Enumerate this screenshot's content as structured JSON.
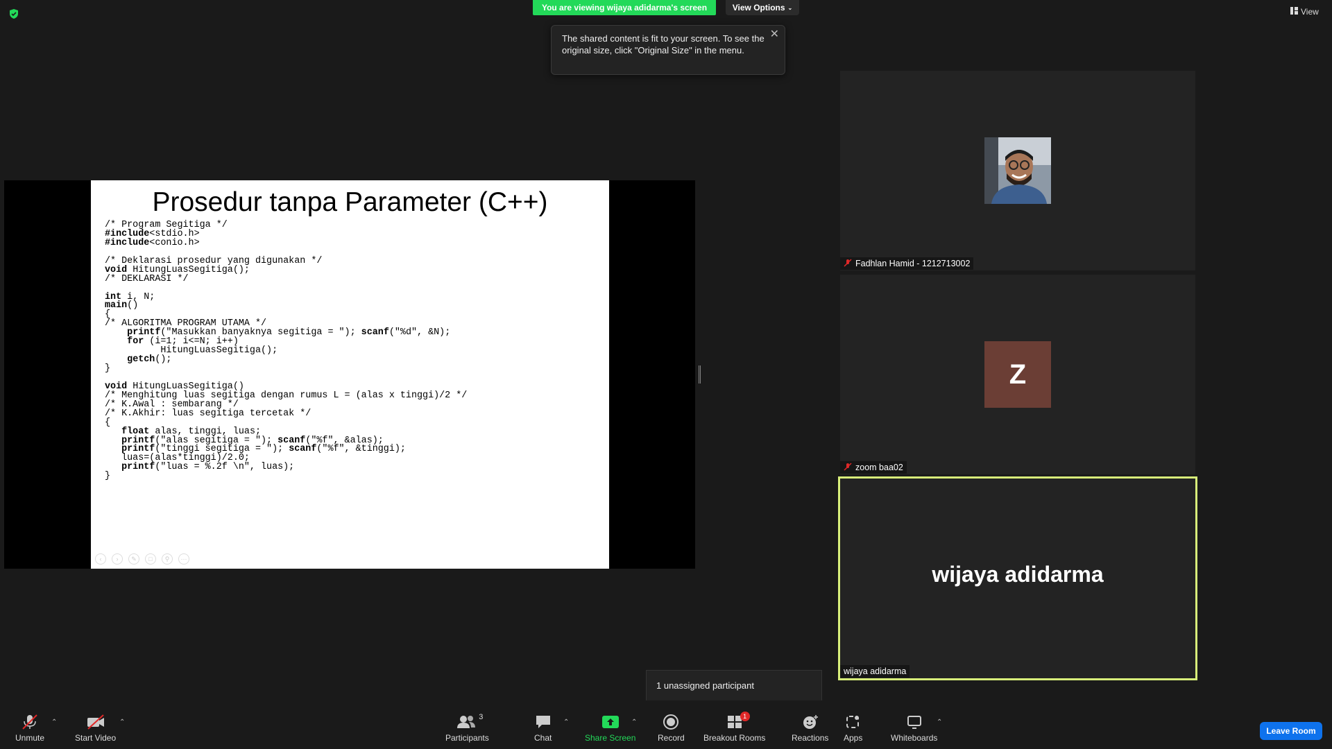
{
  "top": {
    "viewing_banner": "You are viewing wijaya adidarma's screen",
    "view_options": "View Options",
    "view_label": "View"
  },
  "tooltip": {
    "text": "The shared content is fit to your screen. To see the original size, click \"Original Size\" in the menu."
  },
  "slide": {
    "title": "Prosedur tanpa Parameter (C++)",
    "code_lines": [
      "/* Program Segitiga */",
      "#include<stdio.h>",
      "#include<conio.h>",
      "",
      "/* Deklarasi prosedur yang digunakan */",
      "void HitungLuasSegitiga();",
      "/* DEKLARASI */",
      "",
      "int i, N;",
      "main()",
      "{",
      "/* ALGORITMA PROGRAM UTAMA */",
      "    printf(\"Masukkan banyaknya segitiga = \"); scanf(\"%d\", &N);",
      "    for (i=1; i<=N; i++)",
      "          HitungLuasSegitiga();",
      "    getch();",
      "}",
      "",
      "void HitungLuasSegitiga()",
      "/* Menghitung luas segitiga dengan rumus L = (alas x tinggi)/2 */",
      "/* K.Awal : sembarang */",
      "/* K.Akhir: luas segitiga tercetak */",
      "{",
      "   float alas, tinggi, luas;",
      "   printf(\"alas segitiga = \"); scanf(\"%f\", &alas);",
      "   printf(\"tinggi segitiga = \"); scanf(\"%f\", &tinggi);",
      "   luas=(alas*tinggi)/2.0;",
      "   printf(\"luas = %.2f \\n\", luas);",
      "}"
    ]
  },
  "participants_tiles": [
    {
      "name": "Fadhlan Hamid - 1212713002",
      "muted": true
    },
    {
      "name": "zoom baa02",
      "muted": true,
      "initial": "Z",
      "avatar_color": "#6b3e35"
    },
    {
      "name": "wijaya adidarma",
      "big_name": "wijaya adidarma",
      "active_speaker": true
    }
  ],
  "unassigned": "1 unassigned participant",
  "toolbar": {
    "unmute": "Unmute",
    "start_video": "Start Video",
    "participants": "Participants",
    "participants_count": "3",
    "chat": "Chat",
    "share_screen": "Share Screen",
    "record": "Record",
    "breakout_rooms": "Breakout Rooms",
    "breakout_badge": "1",
    "reactions": "Reactions",
    "apps": "Apps",
    "whiteboards": "Whiteboards",
    "leave_room": "Leave Room"
  },
  "colors": {
    "share_green": "#23d959",
    "leave_blue": "#0e72ed",
    "active_border": "#d8ef7a",
    "mute_red": "#e02828"
  }
}
